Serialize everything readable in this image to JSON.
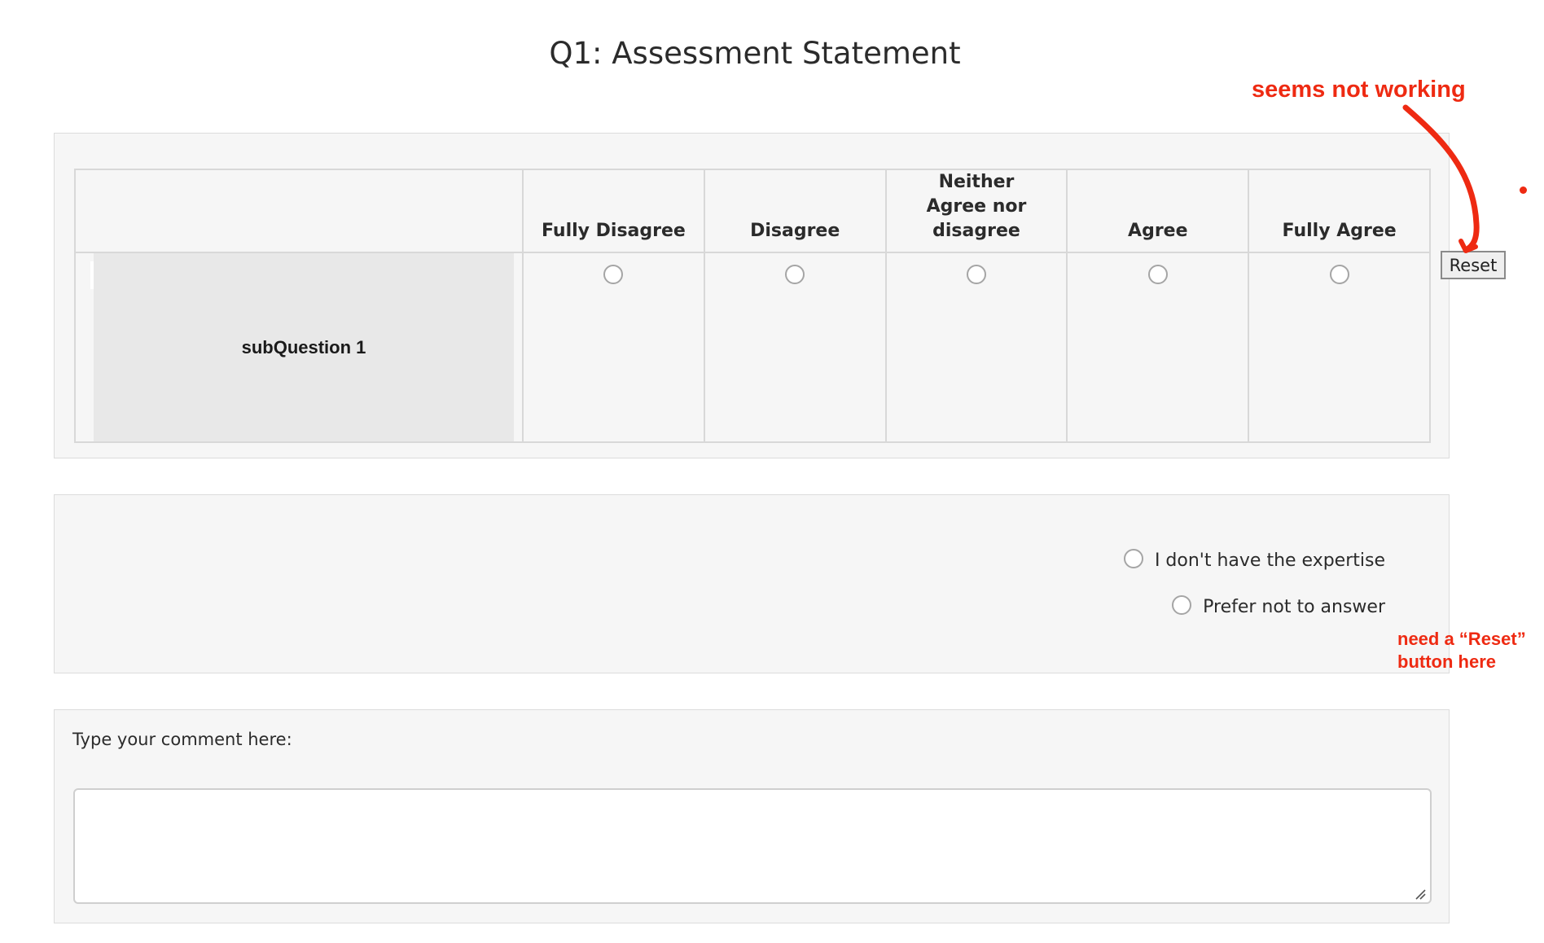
{
  "page": {
    "title": "Q1: Assessment Statement"
  },
  "matrix": {
    "columns": [
      "Fully Disagree",
      "Disagree",
      "Neither Agree nor disagree",
      "Agree",
      "Fully Agree"
    ],
    "rows": [
      {
        "label": "subQuestion 1"
      }
    ],
    "reset_label": "Reset"
  },
  "options": {
    "items": [
      {
        "label": "I don't have the expertise"
      },
      {
        "label": "Prefer not to answer"
      }
    ]
  },
  "comment": {
    "label": "Type your comment here:",
    "value": "",
    "placeholder": ""
  },
  "annotations": {
    "reset_note": "seems not working",
    "missing_reset_note_line1": "need a “Reset”",
    "missing_reset_note_line2": "button here",
    "color": "#ee2a12"
  },
  "icons": {
    "radio": "radio-circle-icon",
    "resize": "resize-grip-icon",
    "arrow": "annotation-arrow-icon"
  }
}
